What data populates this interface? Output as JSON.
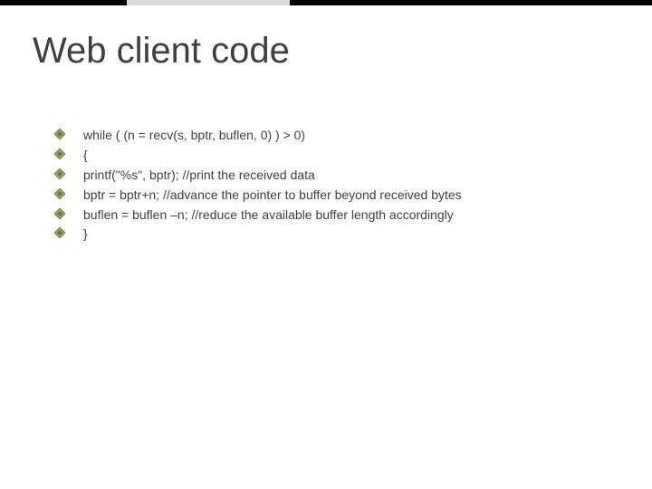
{
  "title": "Web client code",
  "lines": [
    "while ( (n = recv(s, bptr, buflen, 0) ) > 0)",
    "{",
    "printf(\"%s\", bptr);  //print the received data",
    "bptr = bptr+n;  //advance the pointer to buffer beyond received bytes",
    "buflen = buflen –n;  //reduce the available buffer length accordingly",
    "}"
  ],
  "colors": {
    "title": "#3f3f3f",
    "text": "#3f3f3f",
    "bullet_fill": "#9aa36b",
    "bullet_stroke": "#6b7a3a"
  }
}
